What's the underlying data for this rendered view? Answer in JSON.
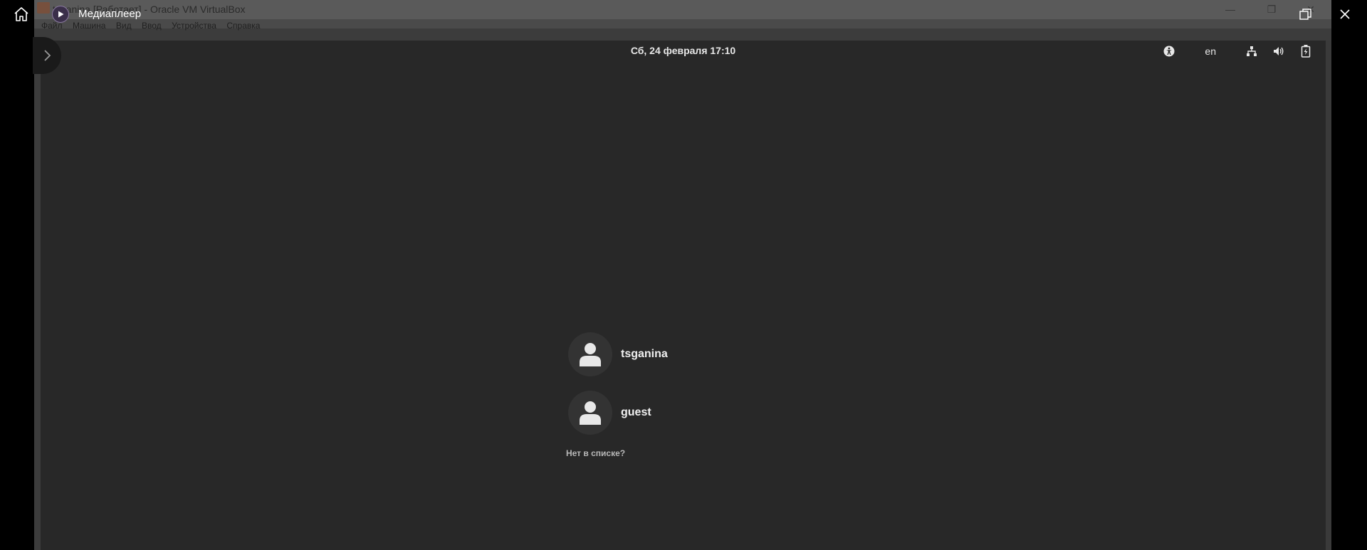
{
  "vbox": {
    "title": "tsganina [Работает] - Oracle VM VirtualBox",
    "menu": [
      "Файл",
      "Машина",
      "Вид",
      "Ввод",
      "Устройства",
      "Справка"
    ],
    "min_label": "—",
    "max_label": "❐",
    "close_label": "✕"
  },
  "media_player": {
    "title": "Медиаплеер"
  },
  "gnome": {
    "clock": "Сб, 24 февраля  17:10",
    "keyboard_layout": "en",
    "icons": [
      "accessibility-icon",
      "network-icon",
      "volume-icon",
      "battery-icon"
    ],
    "users": [
      {
        "name": "tsganina"
      },
      {
        "name": "guest"
      }
    ],
    "not_listed": "Нет в списке?"
  },
  "colors": {
    "screen_bg": "#282828",
    "avatar_bg": "#333333",
    "text": "#f0f0f0"
  }
}
